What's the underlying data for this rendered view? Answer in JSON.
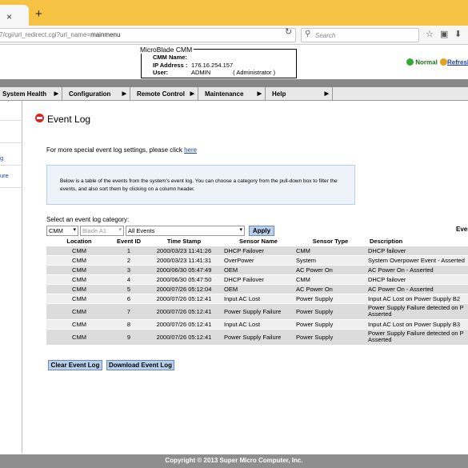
{
  "browser": {
    "new_tab_icon": "+",
    "close_tab_icon": "×",
    "url_prefix": "7/cgi/url_redirect.cgi?url_name=",
    "url_tail": "mainmenu",
    "search_placeholder": "Search"
  },
  "header": {
    "box_title": "MicroBlade CMM",
    "cmm_name_label": "CMM Name:",
    "cmm_name_value": "",
    "ip_label": "IP Address :",
    "ip_value": "176.16.254.157",
    "user_label": "User:",
    "user_value": "ADMIN",
    "user_role": "( Administrator )",
    "status_text": "Normal",
    "refresh_text": "Refresh"
  },
  "menu": [
    {
      "label": "System Health"
    },
    {
      "label": "Configuration"
    },
    {
      "label": "Remote Control"
    },
    {
      "label": "Maintenance"
    },
    {
      "label": "Help"
    }
  ],
  "sidebar": {
    "items": [
      "g",
      "ure"
    ]
  },
  "page": {
    "title": "Event Log",
    "more_text": "For more special event log settings, please click ",
    "more_link": "here",
    "info_text": "Below is a table of the events from the system's event log. You can choose a category from the pull-down box to filter the events, and also sort them by clicking on a column header.",
    "category_label": "Select an event log category:",
    "select_cmm": "CMM",
    "select_blade": "Blade A1",
    "select_events": "All Events",
    "apply_label": "Apply",
    "events_count_label": "Even"
  },
  "table": {
    "headers": [
      "Location",
      "Event ID",
      "Time Stamp",
      "Sensor Name",
      "Sensor Type",
      "Description"
    ],
    "rows": [
      {
        "location": "CMM",
        "id": "1",
        "time": "2000/03/23 11:41:26",
        "sensor": "DHCP Failover",
        "type": "CMM",
        "desc": "DHCP failover"
      },
      {
        "location": "CMM",
        "id": "2",
        "time": "2000/03/23 11:41:31",
        "sensor": "OverPower",
        "type": "System",
        "desc": "System Overpower Event - Asserted"
      },
      {
        "location": "CMM",
        "id": "3",
        "time": "2000/06/30 05:47:49",
        "sensor": "OEM",
        "type": "AC Power On",
        "desc": "AC Power On - Asserted"
      },
      {
        "location": "CMM",
        "id": "4",
        "time": "2000/06/30 05:47:50",
        "sensor": "DHCP Failover",
        "type": "CMM",
        "desc": "DHCP failover"
      },
      {
        "location": "CMM",
        "id": "5",
        "time": "2000/07/26 05:12:04",
        "sensor": "OEM",
        "type": "AC Power On",
        "desc": "AC Power On - Asserted"
      },
      {
        "location": "CMM",
        "id": "6",
        "time": "2000/07/26 05:12:41",
        "sensor": "Input AC Lost",
        "type": "Power Supply",
        "desc": "Input AC Lost on Power Supply B2"
      },
      {
        "location": "CMM",
        "id": "7",
        "time": "2000/07/26 05:12:41",
        "sensor": "Power Supply Failure",
        "type": "Power Supply",
        "desc": "Power Supply Failure detected on P Asserted"
      },
      {
        "location": "CMM",
        "id": "8",
        "time": "2000/07/26 05:12:41",
        "sensor": "Input AC Lost",
        "type": "Power Supply",
        "desc": "Input AC Lost on Power Supply B3"
      },
      {
        "location": "CMM",
        "id": "9",
        "time": "2000/07/26 05:12:41",
        "sensor": "Power Supply Failure",
        "type": "Power Supply",
        "desc": "Power Supply Failure detected on P Asserted"
      }
    ]
  },
  "buttons": {
    "clear": "Clear Event Log",
    "download": "Download Event Log"
  },
  "footer": "Copyright © 2013 Super Micro Computer, Inc."
}
